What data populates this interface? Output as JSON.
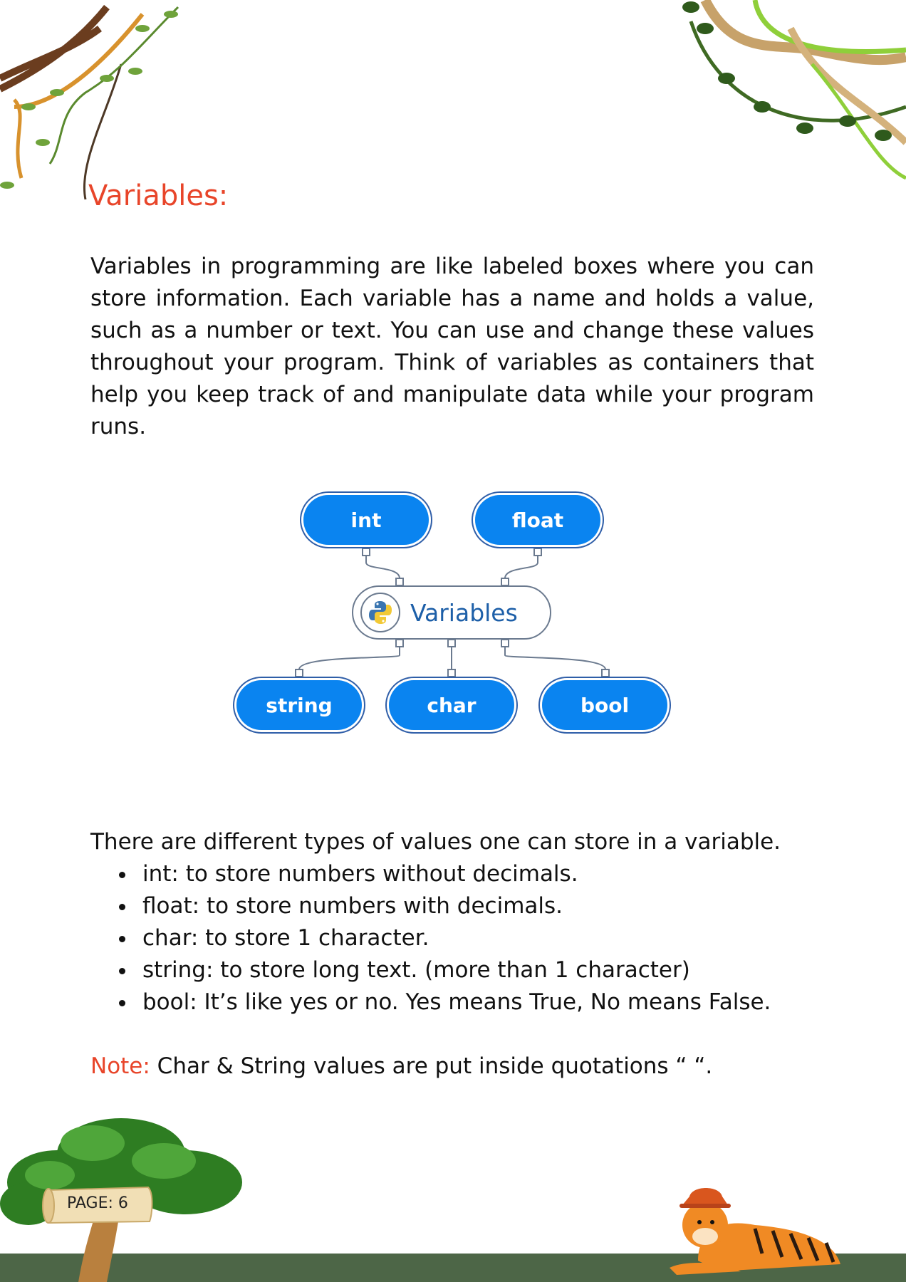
{
  "heading": "Variables:",
  "intro_paragraph": "Variables in programming are like labeled boxes where you can store information. Each variable has a name and holds a value, such as a number or text. You can use and change these values throughout your program. Think of variables as containers that help you keep track of and manipulate data while your program runs.",
  "diagram": {
    "center": "Variables",
    "top_nodes": [
      "int",
      "float"
    ],
    "bottom_nodes": [
      "string",
      "char",
      "bool"
    ]
  },
  "types_intro": "There are different types of values one can store in a variable.",
  "types": [
    "int: to store numbers without decimals.",
    "float: to store numbers with decimals.",
    "char: to store 1 character.",
    "string: to store long text. (more than 1 character)",
    "bool: It’s like yes or no. Yes means True, No means False."
  ],
  "note": {
    "label": "Note:",
    "text": " Char & String values are put inside quotations “ “."
  },
  "page_label": "PAGE: 6",
  "colors": {
    "accent": "#e8452a",
    "pill": "#0a84f0",
    "ground": "#4d6647"
  }
}
